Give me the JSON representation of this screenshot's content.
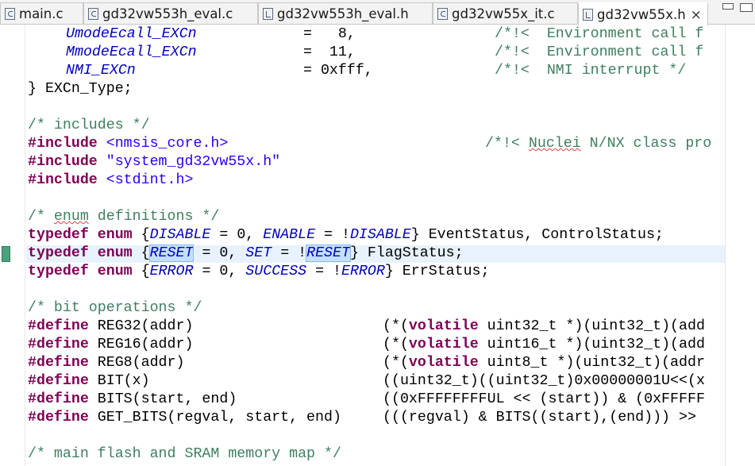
{
  "tabs": [
    {
      "label": "main.c",
      "icon": "c-source-file-icon"
    },
    {
      "label": "gd32vw553h_eval.c",
      "icon": "c-source-file-icon"
    },
    {
      "label": "gd32vw553h_eval.h",
      "icon": "header-file-icon"
    },
    {
      "label": "gd32vw55x_it.c",
      "icon": "c-source-file-icon"
    },
    {
      "label": "gd32vw55x.h",
      "icon": "header-file-icon",
      "active": true
    }
  ],
  "active_tab_close": "×",
  "colors": {
    "keyword": "#7f0055",
    "comment": "#3f7f5f",
    "enum_constant": "#0000c0",
    "string": "#2a00ff",
    "current_line": "#e8f2fe"
  },
  "editor": {
    "l1": {
      "name": "UmodeEcall_EXCn",
      "eq": "=   8,",
      "cm": "/*!<  Environment call f"
    },
    "l2": {
      "name": "MmodeEcall_EXCn",
      "eq": "=  11,",
      "cm": "/*!<  Environment call f"
    },
    "l3": {
      "name": "NMI_EXCn",
      "eq": "= 0xfff,",
      "cm": "/*!<  NMI interrupt */"
    },
    "l4": "} EXCn_Type;",
    "l5": "/* includes */",
    "l6": {
      "kw": "#include",
      "arg": " <nmsis_core.h>",
      "cm_a": "/*!< ",
      "cm_b": "Nuclei",
      "cm_c": " N/NX class pro"
    },
    "l7": {
      "kw": "#include",
      "arg": " \"system_gd32vw55x.h\""
    },
    "l8": {
      "kw": "#include",
      "arg": " <stdint.h>"
    },
    "l9": {
      "a": "/* ",
      "b": "enum",
      "c": " definitions */"
    },
    "l10": {
      "kw1": "typedef",
      "kw2": " enum",
      "t1": " {",
      "e1": "DISABLE",
      "t2": " = 0, ",
      "e2": "ENABLE",
      "t3": " = !",
      "e3": "DISABLE",
      "t4": "} EventStatus, ControlStatus;"
    },
    "l11": {
      "kw1": "typedef",
      "kw2": " enum",
      "t1": " {",
      "e1": "RESET",
      "t2": " = 0, ",
      "e2": "SET",
      "t3": " = !",
      "e3": "RESET",
      "t4": "} FlagStatus;"
    },
    "l12": {
      "kw1": "typedef",
      "kw2": " enum",
      "t1": " {",
      "e1": "ERROR",
      "t2": " = 0, ",
      "e2": "SUCCESS",
      "t3": " = !",
      "e3": "ERROR",
      "t4": "} ErrStatus;"
    },
    "l13": "/* bit operations */",
    "l14": {
      "kw": "#define",
      "name": " REG32(addr)",
      "v1": "(*(",
      "k1": "volatile",
      "v2": " uint32_t *)(uint32_t)(add"
    },
    "l15": {
      "kw": "#define",
      "name": " REG16(addr)",
      "v1": "(*(",
      "k1": "volatile",
      "v2": " uint16_t *)(uint32_t)(add"
    },
    "l16": {
      "kw": "#define",
      "name": " REG8(addr)",
      "v1": "(*(",
      "k1": "volatile",
      "v2": " uint8_t *)(uint32_t)(addr"
    },
    "l17": {
      "kw": "#define",
      "name": " BIT(x)",
      "v1": "((uint32_t)((uint32_t)0x00000001U<<(x"
    },
    "l18": {
      "kw": "#define",
      "name": " BITS(start, end)",
      "v1": "((0xFFFFFFFFUL << (start)) & (0xFFFFF"
    },
    "l19": {
      "kw": "#define",
      "name": " GET_BITS(regval, start, end)",
      "v1": "(((regval) & BITS((start),(end))) >> "
    },
    "l20": "/* main flash and SRAM memory map */"
  }
}
